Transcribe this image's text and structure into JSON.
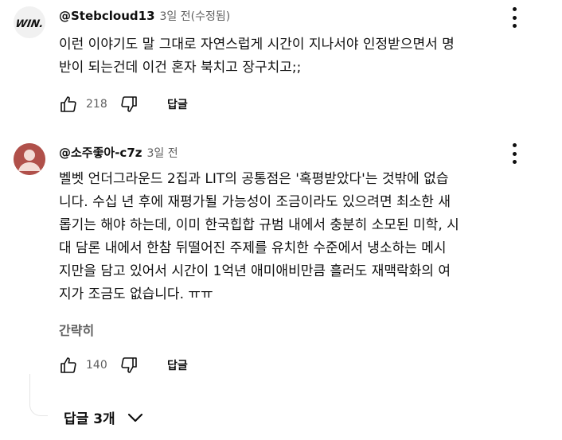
{
  "comments": [
    {
      "author": "@Stebcloud13",
      "time": "3일 전(수정됨)",
      "avatar_text": "WIN.",
      "lines": [
        "이런 이야기도 말 그대로 자연스럽게 시간이 지나서야 인정받으면서 명",
        "반이 되는건데 이건 혼자 북치고 장구치고;;"
      ],
      "likes": "218",
      "reply_label": "답글"
    },
    {
      "author": "@소주좋아-c7z",
      "time": "3일 전",
      "lines": [
        "벨벳 언더그라운드 2집과 LIT의 공통점은 '혹평받았다'는 것밖에 없습",
        "니다. 수십 년 후에 재평가될 가능성이 조금이라도 있으려면 최소한 새",
        "롭기는 해야 하는데, 이미 한국힙합 규범 내에서 충분히 소모된 미학, 시",
        "대 담론 내에서 한참 뒤떨어진 주제를 유치한 수준에서 냉소하는 메시",
        "지만을 담고 있어서 시간이 1억년 애미애비만큼 흘러도 재맥락화의 여",
        "지가 조금도 없습니다. ㅠㅠ"
      ],
      "collapse_label": "간략히",
      "likes": "140",
      "reply_label": "답글",
      "replies_label": "답글 3개"
    }
  ],
  "colors": {
    "text": "#0f0f0f",
    "secondary": "#606060",
    "avatar_bg": "#b0504a"
  },
  "icons": [
    "more-vert-icon",
    "thumb-up-icon",
    "thumb-down-icon",
    "chevron-down-icon",
    "person-icon"
  ]
}
